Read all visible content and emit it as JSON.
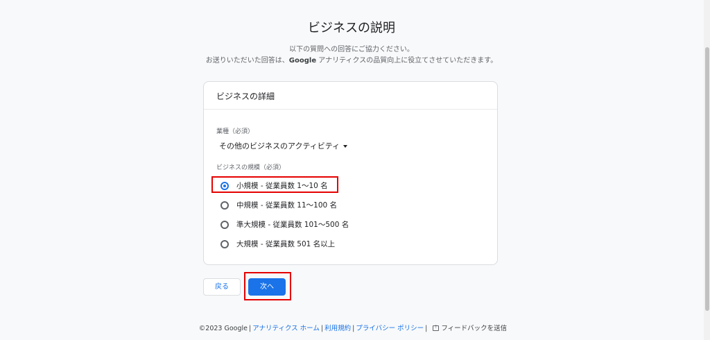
{
  "page": {
    "title": "ビジネスの説明",
    "subtitle_line1": "以下の質問への回答にご協力ください。",
    "subtitle_line2_pre": "お送りいただいた回答は、",
    "subtitle_line2_brand": "Google",
    "subtitle_line2_post": " アナリティクスの品質向上に役立てさせていただきます。"
  },
  "card": {
    "header": "ビジネスの詳細",
    "industry_label": "業種（必須）",
    "industry_value": "その他のビジネスのアクティビティ",
    "size_label": "ビジネスの規模（必須）",
    "size_options": [
      {
        "label": "小規模 - 従業員数 1〜10 名",
        "selected": true
      },
      {
        "label": "中規模 - 従業員数 11〜100 名",
        "selected": false
      },
      {
        "label": "準大規模 - 従業員数 101〜500 名",
        "selected": false
      },
      {
        "label": "大規模 - 従業員数 501 名以上",
        "selected": false
      }
    ]
  },
  "buttons": {
    "back": "戻る",
    "next": "次へ"
  },
  "footer": {
    "copyright": "©2023 Google",
    "analytics_home": "アナリティクス ホーム",
    "terms": "利用規約",
    "privacy": "プライバシー ポリシー",
    "feedback": "フィードバックを送信"
  },
  "colors": {
    "accent": "#1a73e8",
    "highlight": "#e50000"
  },
  "icons": {
    "dropdown": "caret-down-icon",
    "feedback": "feedback-icon"
  }
}
